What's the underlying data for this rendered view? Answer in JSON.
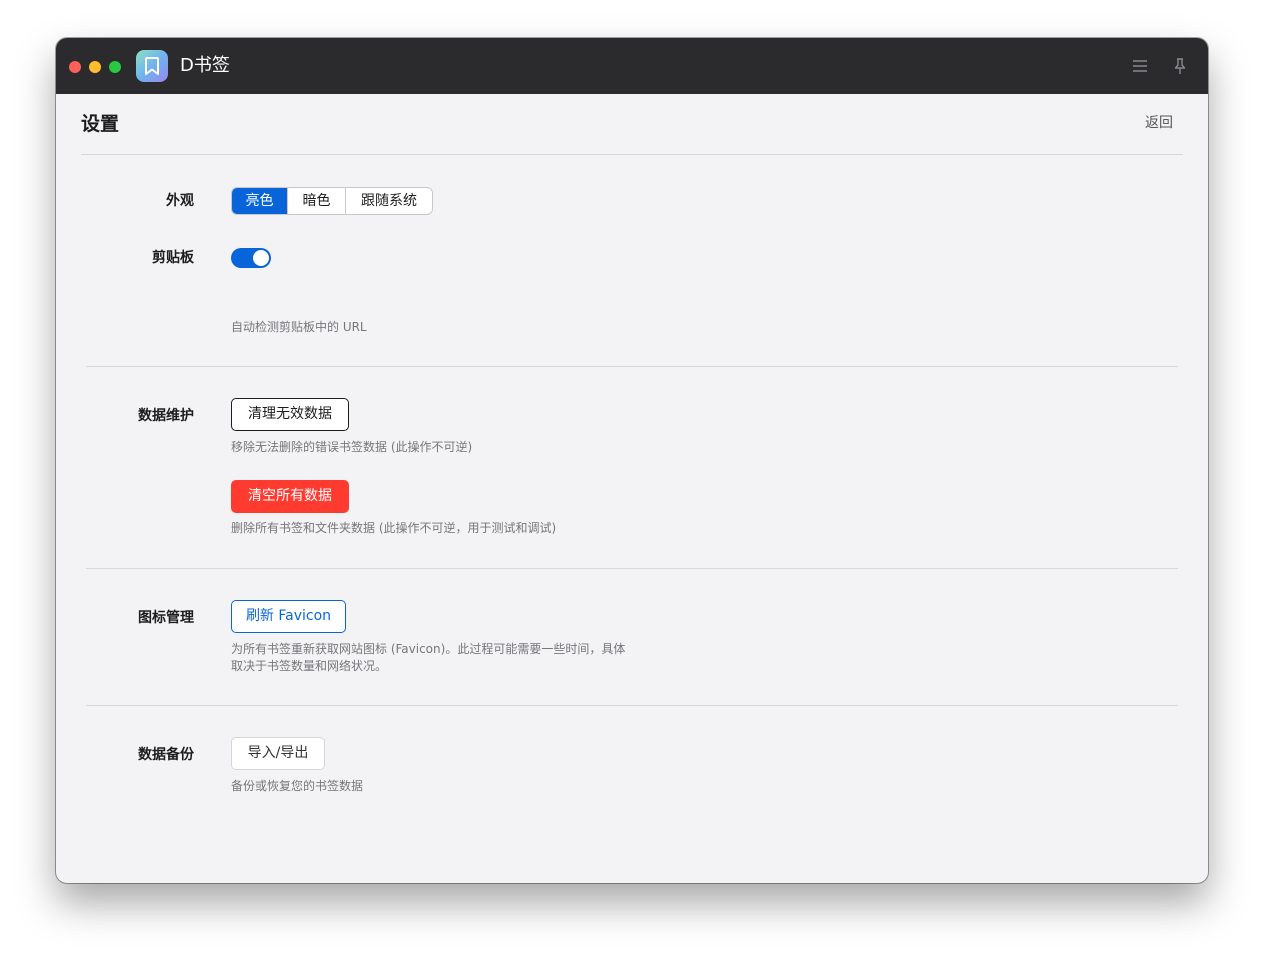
{
  "window": {
    "app_title": "D书签",
    "app_icon": "bookmark-icon",
    "toolbar_icons": [
      "menu-icon",
      "pin-icon"
    ],
    "accent": "#0a64d9"
  },
  "page": {
    "title": "设置",
    "back_label": "返回"
  },
  "appearance": {
    "label": "外观",
    "options": [
      "亮色",
      "暗色",
      "跟随系统"
    ],
    "selected": "亮色"
  },
  "clipboard": {
    "label": "剪贴板",
    "enabled": true,
    "description": "自动检测剪贴板中的 URL"
  },
  "maintenance": {
    "label": "数据维护",
    "clean_invalid_label": "清理无效数据",
    "clean_invalid_desc": "移除无法删除的错误书签数据 (此操作不可逆)",
    "clear_all_label": "清空所有数据",
    "clear_all_desc": "删除所有书签和文件夹数据 (此操作不可逆，用于测试和调试)",
    "danger_color": "#ff3b30"
  },
  "icons": {
    "label": "图标管理",
    "refresh_label": "刷新 Favicon",
    "desc_line1": "为所有书签重新获取网站图标 (Favicon)。此过程可能需要一些时间，具体",
    "desc_line2": "取决于书签数量和网络状况。"
  },
  "backup": {
    "label": "数据备份",
    "import_export_label": "导入/导出",
    "description": "备份或恢复您的书签数据"
  }
}
